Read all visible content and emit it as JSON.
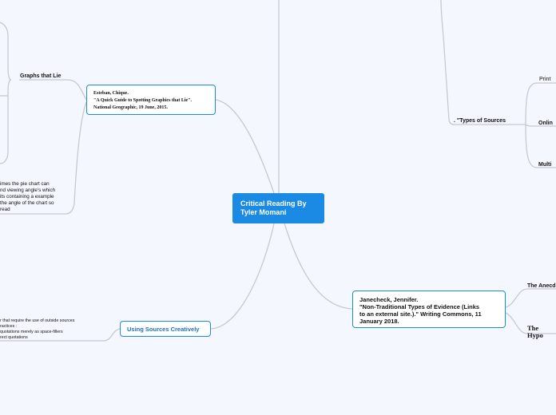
{
  "central": {
    "title": "Critical Reading By\nTyler Momani"
  },
  "left": {
    "graphs_that_lie": "Graphs that Lie",
    "citation": "Esteban, Chique.\n\"A Quick Guide to Spotting Graphics that Lie\".\n National Geographic, 19 June, 2015.",
    "pie_note": "imes the pie chart can\nnd viewing angle's which\nits containing a example\n the angle of the chart so\nread",
    "using_sources": "Using Sources Creatively",
    "sources_note": "r that require the use of outside sources\nractices :\n quotations merely as space-fillers\nrect quotations"
  },
  "right": {
    "types_of_sources": ". \"Types of Sources",
    "print": "Print",
    "online": "Onlin",
    "multimedia": "Multi",
    "citation": "Janecheck, Jennifer.\n\"Non-Traditional Types of Evidence (Links\nto an external site.).\" Writing Commons, 11\nJanuary 2018.",
    "anecdote": "The Anecd",
    "hypothetical": "The Hypo"
  },
  "colors": {
    "central_fill": "#1b8ae4",
    "node_border": "#1b8ae4",
    "link_text": "#1b6fc4",
    "connector": "#c5c9d3",
    "background": "#f5f7fe"
  }
}
